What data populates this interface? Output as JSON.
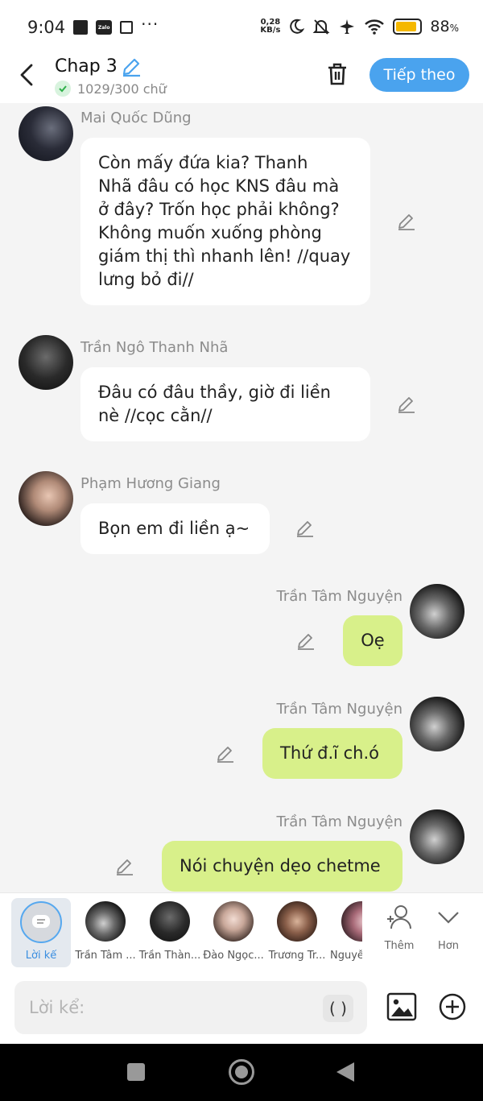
{
  "status": {
    "time": "9:04",
    "speed_value": "0,28",
    "speed_unit": "KB/s",
    "battery_pct": "88",
    "battery_unit": "%",
    "battery_level": 0.88
  },
  "header": {
    "title": "Chap 3",
    "word_count": "1029/300 chữ",
    "next_label": "Tiếp theo"
  },
  "messages": [
    {
      "sender": "Mai Quốc Dũng",
      "lines": [
        "Còn mấy đứa kia? Thanh",
        "Nhã đâu có học KNS đâu mà",
        "ở đây? Trốn học phải không?",
        "Không muốn xuống phòng",
        "giám thị thì nhanh lên! //quay",
        "lưng bỏ đi//"
      ],
      "mine": false
    },
    {
      "sender": "Trần Ngô Thanh Nhã",
      "lines": [
        "Đâu có đâu thầy, giờ đi liền",
        "nè //cọc cằn//"
      ],
      "mine": false
    },
    {
      "sender": "Phạm Hương Giang",
      "lines": [
        "Bọn em đi liền ạ~"
      ],
      "mine": false
    },
    {
      "sender": "Trần Tâm Nguyện",
      "lines": [
        "Oẹ"
      ],
      "mine": true
    },
    {
      "sender": "Trần Tâm Nguyện",
      "lines": [
        "Thứ đ.ĩ ch.ó"
      ],
      "mine": true
    },
    {
      "sender": "Trần Tâm Nguyện",
      "lines": [
        "Nói chuyện dẹo chetme"
      ],
      "mine": true
    }
  ],
  "characters": {
    "narrator_label": "Lời kể",
    "items": [
      "Trần Tâm ...",
      "Trần Thàn...",
      "Đào Ngọc...",
      "Trương Tr...",
      "Nguyễ"
    ],
    "add_label": "Thêm",
    "more_label": "Hơn"
  },
  "input": {
    "placeholder": "Lời kể:",
    "paren_label": "( )"
  },
  "icons": [
    "back-arrow-icon",
    "pencil-icon",
    "check-icon",
    "trash-icon",
    "image-icon",
    "plus-circle-icon",
    "add-person-icon",
    "chevron-down-icon"
  ],
  "colors": {
    "accent": "#4aa3ee",
    "my_bubble": "#d8f08a",
    "battery": "#f5b800"
  }
}
